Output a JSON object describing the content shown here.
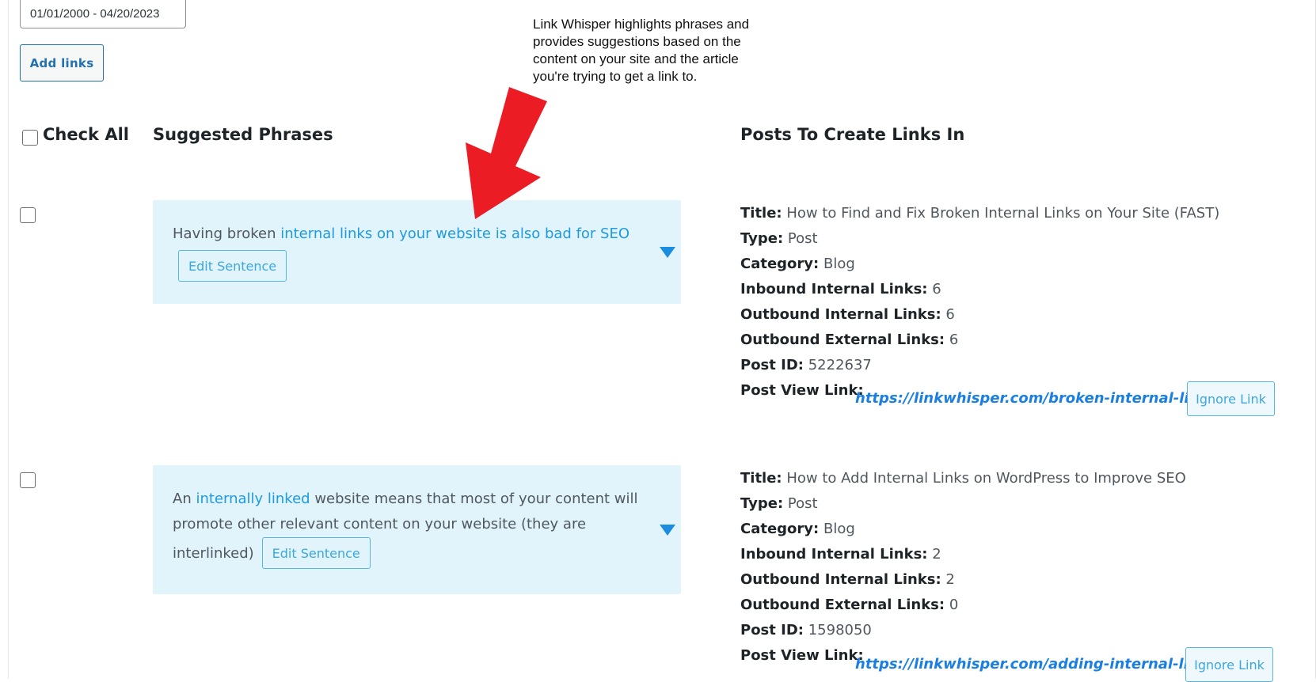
{
  "filters": {
    "date_range": "01/01/2000 - 04/20/2023",
    "add_links_label": "Add links"
  },
  "headers": {
    "check_all": "Check All",
    "suggested_phrases": "Suggested Phrases",
    "posts_to_create_links_in": "Posts To Create Links In"
  },
  "callout": {
    "text": "Link Whisper highlights phrases and provides suggestions based on the content on your site and the article you're trying to get a link to.",
    "arrow_color": "#ec1c24"
  },
  "labels": {
    "title": "Title:",
    "type": "Type:",
    "category": "Category:",
    "inbound_internal": "Inbound Internal Links:",
    "outbound_internal": "Outbound Internal Links:",
    "outbound_external": "Outbound External Links:",
    "post_id": "Post ID:",
    "post_view_link": "Post View Link:",
    "edit_sentence": "Edit Sentence",
    "ignore_link": "Ignore Link"
  },
  "suggestions": [
    {
      "sentence_before": "Having broken ",
      "sentence_highlight": "internal links on your website is also bad for SEO",
      "sentence_after": "",
      "post": {
        "title": "How to Find and Fix Broken Internal Links on Your Site (FAST)",
        "type": "Post",
        "category": "Blog",
        "inbound_internal": "6",
        "outbound_internal": "6",
        "outbound_external": "6",
        "post_id": "5222637",
        "view_link": "https://linkwhisper.com/broken-internal-links/"
      }
    },
    {
      "sentence_before": "An ",
      "sentence_highlight": "internally linked",
      "sentence_line1_after": " website means that most of your content will",
      "sentence_line2": "promote other relevant content on your website (they are",
      "sentence_line3": "interlinked)",
      "post": {
        "title": "How to Add Internal Links on WordPress to Improve SEO",
        "type": "Post",
        "category": "Blog",
        "inbound_internal": "2",
        "outbound_internal": "2",
        "outbound_external": "0",
        "post_id": "1598050",
        "view_link": "https://linkwhisper.com/adding-internal-links/"
      }
    }
  ],
  "colors": {
    "highlight": "#1e9ae2",
    "phrase_bg": "#e1f4fc",
    "link": "#1a7fe0"
  }
}
